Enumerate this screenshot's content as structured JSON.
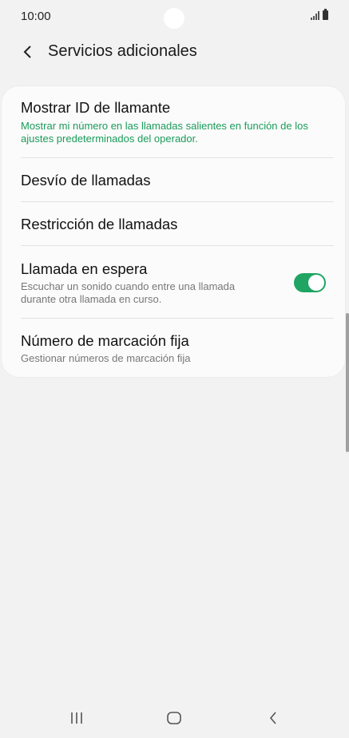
{
  "status": {
    "time": "10:00"
  },
  "header": {
    "title": "Servicios adicionales",
    "back_icon": "chevron-left-icon"
  },
  "items": [
    {
      "title": "Mostrar ID de llamante",
      "subtitle": "Mostrar mi número en las llamadas salientes en función de los ajustes predeterminados del operador."
    },
    {
      "title": "Desvío de llamadas"
    },
    {
      "title": "Restricción de llamadas"
    },
    {
      "title": "Llamada en espera",
      "subtitle": "Escuchar un sonido cuando entre una llamada durante otra llamada en curso.",
      "toggle_on": true
    },
    {
      "title": "Número de marcación fija",
      "subtitle": "Gestionar números de marcación fija"
    }
  ],
  "colors": {
    "accent": "#1fa463",
    "background": "#f2f2f2",
    "card": "#fbfbfb"
  },
  "navbar": {
    "icons": [
      "recents-icon",
      "home-icon",
      "back-icon"
    ]
  }
}
